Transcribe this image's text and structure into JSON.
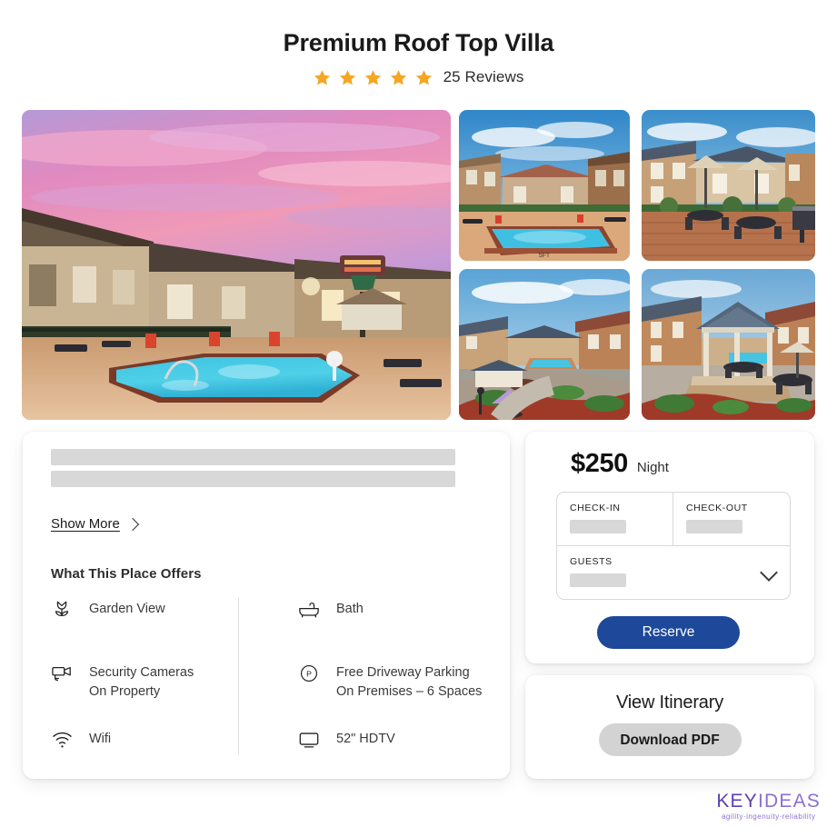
{
  "header": {
    "title": "Premium Roof Top Villa",
    "star_count": 5,
    "star_color": "#F5A623",
    "reviews": "25 Reviews"
  },
  "gallery": {
    "photos": [
      {
        "name": "hero-photo",
        "alt": "Motel courtyard pool at sunset with pink purple sky"
      },
      {
        "name": "thumb-photo-1",
        "alt": "Outdoor swimming pool with brick deck and lounge chairs"
      },
      {
        "name": "thumb-photo-2",
        "alt": "Patio with umbrella tables and grill on brick pavers"
      },
      {
        "name": "thumb-photo-3",
        "alt": "Courtyard with purple umbrella and pool"
      },
      {
        "name": "thumb-photo-4",
        "alt": "Gazebo with patio seating and landscaping"
      }
    ]
  },
  "details": {
    "skeleton_lines": 2,
    "show_more_label": "Show More",
    "offers_title": "What This Place Offers",
    "amenities_left": [
      {
        "icon": "tulip-flower-icon",
        "label": "Garden View"
      },
      {
        "icon": "security-camera-icon",
        "label": "Security Cameras\nOn Property"
      },
      {
        "icon": "wifi-icon",
        "label": "Wifi"
      }
    ],
    "amenities_right": [
      {
        "icon": "bathtub-icon",
        "label": "Bath"
      },
      {
        "icon": "parking-icon",
        "label": "Free Driveway Parking\nOn Premises – 6 Spaces"
      },
      {
        "icon": "hdtv-monitor-icon",
        "label": "52\" HDTV"
      }
    ]
  },
  "booking": {
    "price": "$250",
    "price_unit": "Night",
    "checkin_label": "CHECK-IN",
    "checkin_value": "",
    "checkout_label": "CHECK-OUT",
    "checkout_value": "",
    "guests_label": "GUESTS",
    "guests_value": "",
    "reserve_label": "Reserve",
    "reserve_color": "#1e4899"
  },
  "itinerary": {
    "title": "View Itinerary",
    "download_label": "Download PDF",
    "download_color": "#d3d3d3"
  },
  "logo": {
    "part_1": "KEY",
    "part_2": "IDEAS",
    "tagline": "agility·ingenuity·reliability",
    "color_1": "#5b3fb3",
    "color_2": "#8b6fd4"
  }
}
